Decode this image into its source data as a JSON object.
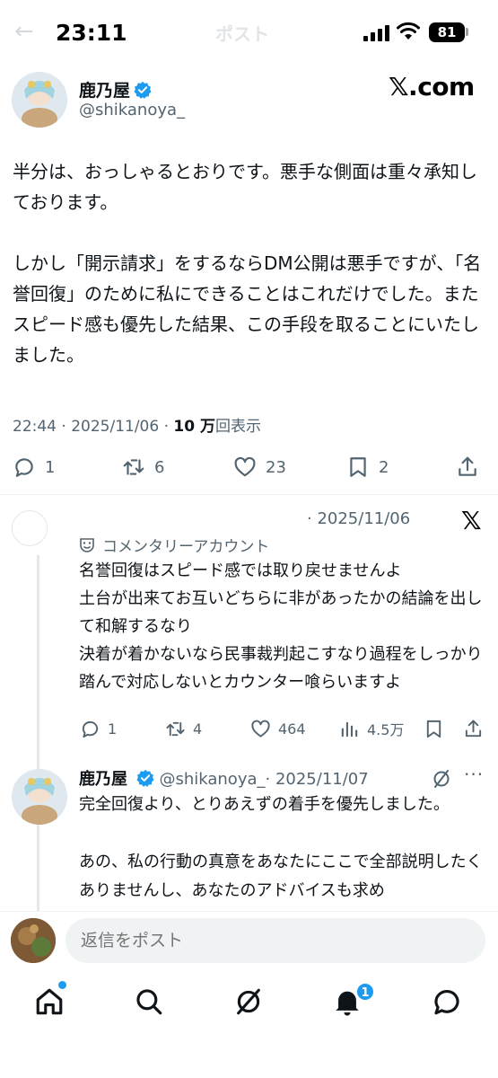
{
  "status_bar": {
    "time": "23:11",
    "battery": "81",
    "ghost_title": "ポスト"
  },
  "author": {
    "name": "鹿乃屋",
    "handle": "@shikanoya_",
    "brand": "𝕏.com"
  },
  "tweet": {
    "text": "半分は、おっしゃるとおりです。悪手な側面は重々承知しております。\n\nしかし「開示請求」をするならDM公開は悪手ですが、「名誉回復」のために私にできることはこれだけでした。またスピード感も優先した結果、この手段を取ることにいたしました。",
    "time": "22:44 · 2025/11/06 · ",
    "views_count": "10 万",
    "views_label": "回表示",
    "replies": "1",
    "reposts": "6",
    "likes": "23",
    "bookmarks": "2"
  },
  "reply1": {
    "date": "· 2025/11/06",
    "brand": "𝕏",
    "label": "コメンタリーアカウント",
    "text": "名誉回復はスピード感では取り戻せませんよ\n土台が出来てお互いどちらに非があったかの結論を出して和解するなり\n決着が着かないなら民事裁判起こすなり過程をしっかり踏んで対応しないとカウンター喰らいますよ",
    "replies": "1",
    "reposts": "4",
    "likes": "464",
    "views": "4.5万"
  },
  "reply2": {
    "name": "鹿乃屋",
    "handle_date": "@shikanoya_· 2025/11/07",
    "more": "···",
    "text": "完全回復より、とりあえずの着手を優先しました。\n\nあの、私の行動の真意をあなたにここで全部説明したくありませんし、あなたのアドバイスも求め"
  },
  "compose": {
    "placeholder": "返信をポスト"
  },
  "nav": {
    "notifications_count": "1"
  },
  "colors": {
    "accent": "#1d9bf0",
    "text": "#0f1419",
    "muted": "#536471"
  }
}
